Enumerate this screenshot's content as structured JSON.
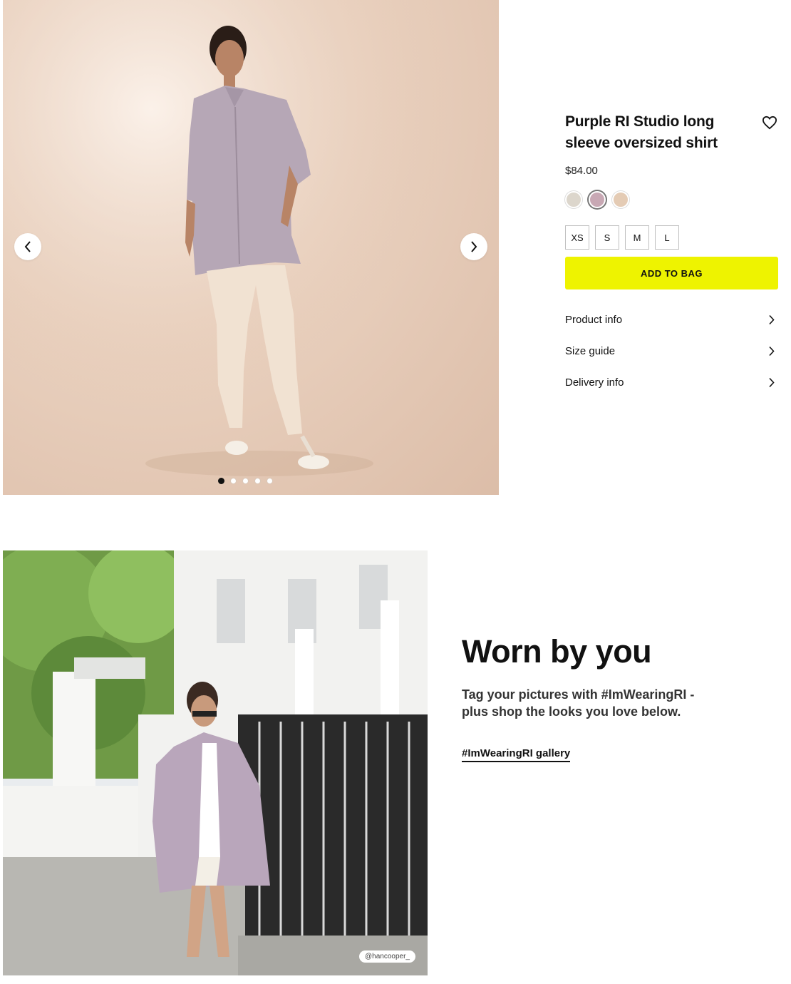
{
  "product": {
    "title": "Purple RI Studio long sleeve oversized shirt",
    "price": "$84.00",
    "colors": [
      {
        "name": "stone",
        "hex": "#dcd6cc"
      },
      {
        "name": "purple",
        "hex": "#c8a8b4",
        "selected": true
      },
      {
        "name": "beige",
        "hex": "#e4cbb4"
      }
    ],
    "sizes": [
      "XS",
      "S",
      "M",
      "L"
    ],
    "add_to_bag_label": "ADD TO BAG",
    "info_links": [
      "Product info",
      "Size guide",
      "Delivery info"
    ]
  },
  "gallery": {
    "slide_count": 5,
    "active_index": 0
  },
  "ugc": {
    "heading": "Worn by you",
    "description": "Tag your pictures with #ImWearingRI - plus shop the looks you love below.",
    "link_label": "#ImWearingRI gallery",
    "photo_credit": "@hancooper_"
  },
  "icons": [
    "chevron-left-icon",
    "chevron-right-icon",
    "heart-icon"
  ],
  "colors": {
    "add_to_bag": "#eef300",
    "text": "#111111"
  }
}
